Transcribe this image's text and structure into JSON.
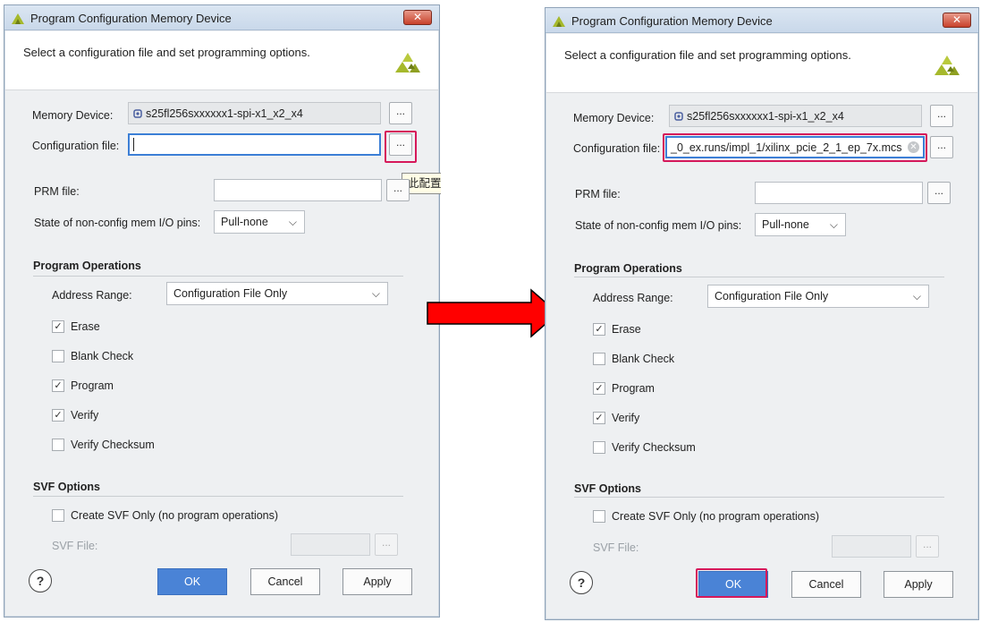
{
  "dialog_title": "Program Configuration Memory Device",
  "header_text": "Select a configuration file and set programming options.",
  "labels": {
    "memory_device": "Memory Device:",
    "configuration_file": "Configuration file:",
    "prm_file": "PRM file:",
    "state_pins": "State of non-config mem I/O pins:",
    "address_range": "Address Range:",
    "svf_file": "SVF File:"
  },
  "memory_device_value": "s25fl256sxxxxxx1-spi-x1_x2_x4",
  "browse_label": "...",
  "close_label": "✕",
  "state_pins_value": "Pull-none",
  "sections": {
    "program_operations": "Program Operations",
    "svf_options": "SVF Options"
  },
  "address_range_value": "Configuration File Only",
  "options": {
    "erase": "Erase",
    "blank_check": "Blank Check",
    "program": "Program",
    "verify": "Verify",
    "verify_checksum": "Verify Checksum",
    "create_svf": "Create SVF Only (no program operations)"
  },
  "buttons": {
    "help": "?",
    "ok": "OK",
    "cancel": "Cancel",
    "apply": "Apply"
  },
  "left_dialog": {
    "configuration_file_value": "",
    "tooltip": "此配置文"
  },
  "right_dialog": {
    "configuration_file_value": "_0_ex.runs/impl_1/xilinx_pcie_2_1_ep_7x.mcs"
  },
  "colors": {
    "highlight": "#d6185a",
    "arrow": "#ff0000",
    "ok_button": "#4a83d6",
    "logo_yellow_green": "#a6b92c"
  },
  "icons": {
    "title_logo": "xilinx-logo-icon",
    "device": "chip-icon",
    "dropdown": "chevron-down-icon",
    "clear": "clear-icon"
  }
}
